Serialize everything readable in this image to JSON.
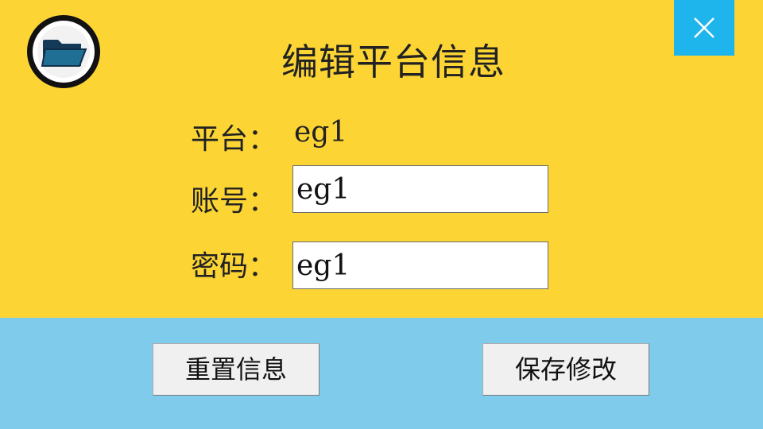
{
  "window": {
    "title": "编辑平台信息",
    "close_icon": "close-icon",
    "logo_icon": "folder-icon"
  },
  "form": {
    "platform": {
      "label": "平台：",
      "value": "eg1"
    },
    "account": {
      "label": "账号：",
      "value": "eg1"
    },
    "password": {
      "label": "密码：",
      "value": "eg1"
    }
  },
  "actions": {
    "reset_label": "重置信息",
    "save_label": "保存修改"
  },
  "colors": {
    "top_panel": "#fcd535",
    "bottom_panel": "#7ecbeb",
    "close_button": "#1eb4ec"
  }
}
